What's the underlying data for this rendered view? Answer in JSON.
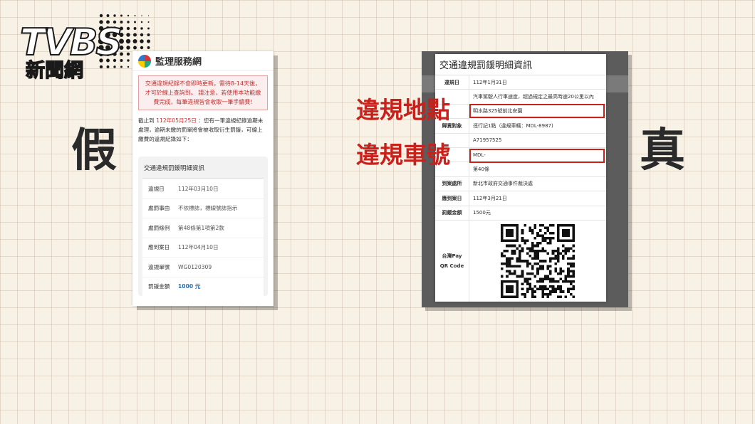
{
  "logo": {
    "brand": "TVBS",
    "name": "新聞網"
  },
  "labels": {
    "fake": "假",
    "real": "真",
    "location": "違規地點",
    "plate": "違規車號"
  },
  "left_screen": {
    "site_title": "監理服務網",
    "warning": "交通違規紀錄不會即時更新，需待8-14天後，才可於線上查詢到。 請注意，若使用本功能繳費完成，每筆違規皆會收取一筆手續費!",
    "notice_prefix": "截止到",
    "notice_date": "112年05月25日",
    "notice_body": "：您有一筆違規紀錄逾期未處理，逾期未繳的罰單將會被收取衍生罰鍰，可線上繳費的違規紀錄如下：",
    "box_title": "交通違規罰鍰明細資訊",
    "rows": [
      {
        "key": "違規日",
        "value": "112年03月10日"
      },
      {
        "key": "處罰事由",
        "value": "不依標誌，標線號誌指示"
      },
      {
        "key": "處罰條例",
        "value": "第48條第1項第2款"
      },
      {
        "key": "應到案日",
        "value": "112年04月10日"
      },
      {
        "key": "違規單號",
        "value": "WG0120309"
      },
      {
        "key": "罰鍰金額",
        "value": "1000 元"
      }
    ]
  },
  "right_screen": {
    "title": "交通違規罰鍰明細資訊",
    "rows": [
      {
        "key": "違規日",
        "value": "112年1月31日"
      },
      {
        "key": "",
        "value": "汽車駕駛人行車速度，超過規定之最高時速20公里以內"
      },
      {
        "key": "",
        "value": "明水路325號前北安園"
      },
      {
        "key": "歸責對象",
        "value": "逕行記1點（違規車輛：MDL-8987)"
      },
      {
        "key": "",
        "value": "A71957525"
      },
      {
        "key": "",
        "value": "MDL-"
      },
      {
        "key": "",
        "value": "第40條"
      },
      {
        "key": "到案處所",
        "value": "新北市政府交通事件裁決處"
      },
      {
        "key": "應到案日",
        "value": "112年3月21日"
      },
      {
        "key": "罰鍰金額",
        "value": "1500元"
      }
    ],
    "qr_label_1": "台灣Pay",
    "qr_label_2": "QR Code"
  },
  "colors": {
    "accent_red": "#c8201b",
    "background": "#f7f1e6"
  }
}
